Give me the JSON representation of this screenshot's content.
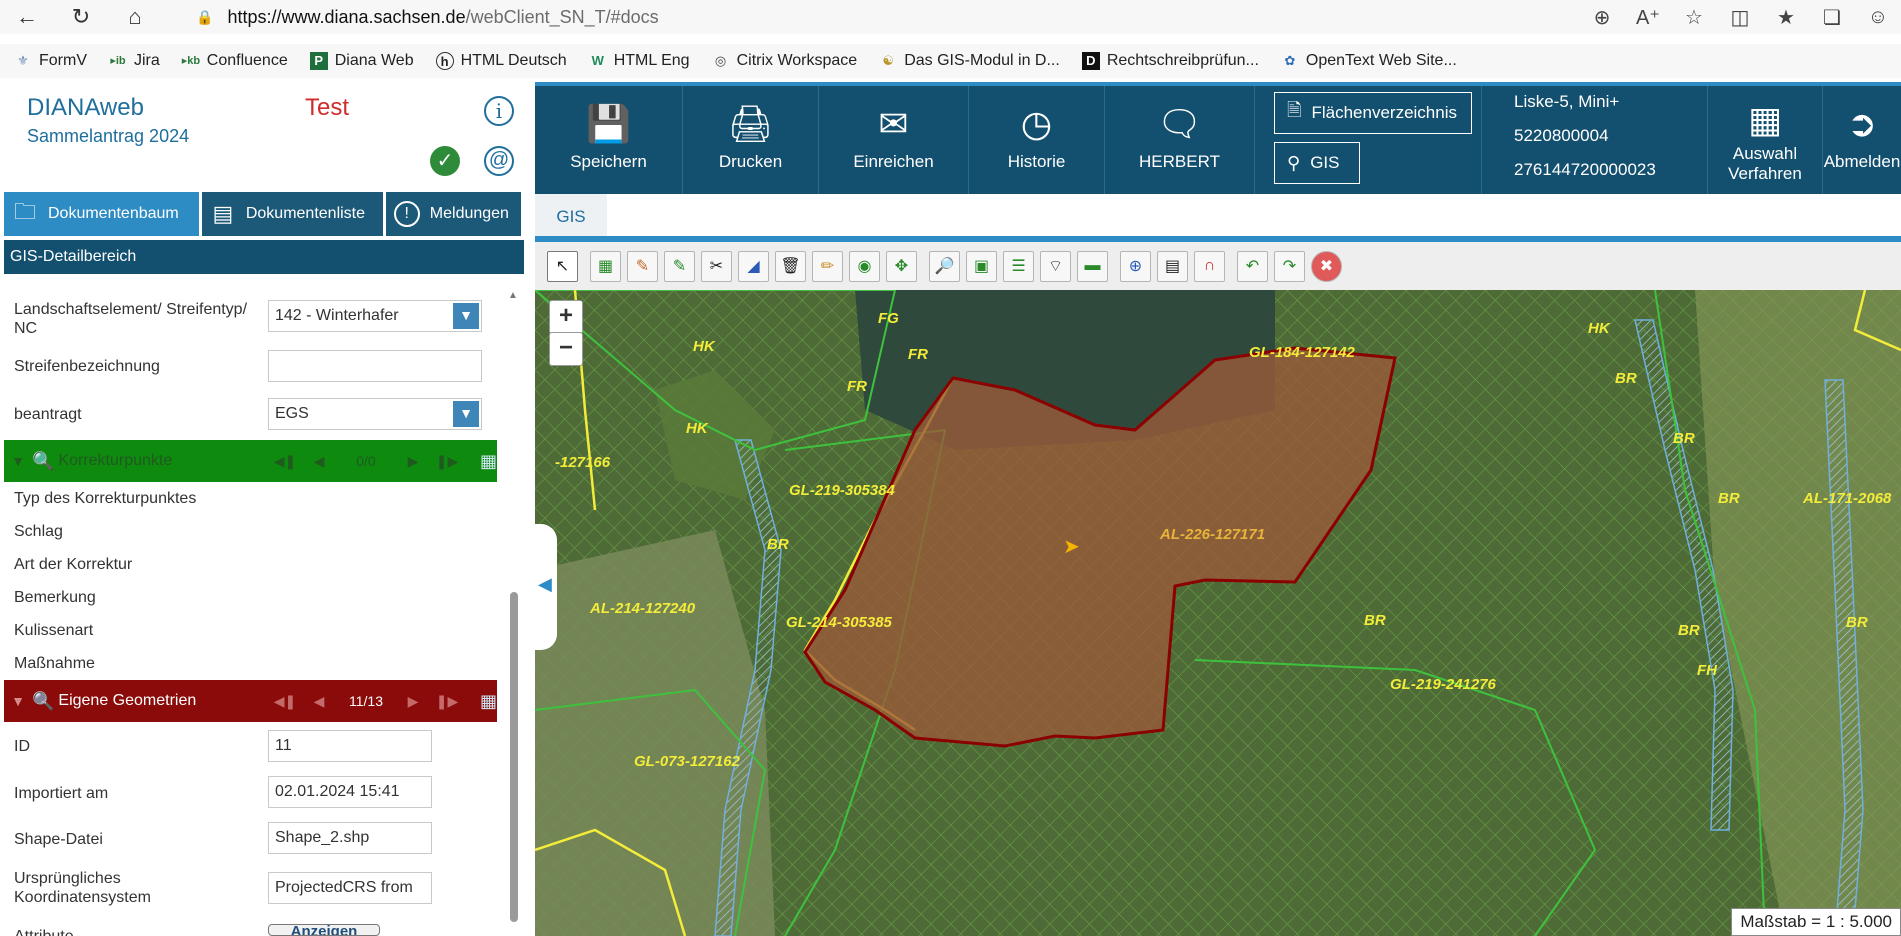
{
  "browser": {
    "url_host": "https://www.diana.sachsen.de",
    "url_path": "/webClient_SN_T/#docs"
  },
  "bookmarks": [
    {
      "label": "FormV",
      "icon": "wheat-icon"
    },
    {
      "label": "Jira",
      "icon": "kb-icon"
    },
    {
      "label": "Confluence",
      "icon": "kb-icon"
    },
    {
      "label": "Diana Web",
      "icon": "p-icon"
    },
    {
      "label": "HTML Deutsch",
      "icon": "h-icon"
    },
    {
      "label": "HTML Eng",
      "icon": "w-icon"
    },
    {
      "label": "Citrix Workspace",
      "icon": "citrix-icon"
    },
    {
      "label": "Das GIS-Modul in D...",
      "icon": "saxony-icon"
    },
    {
      "label": "Rechtschreibprüfun...",
      "icon": "d-icon"
    },
    {
      "label": "OpenText Web Site...",
      "icon": "opentext-icon"
    }
  ],
  "app": {
    "title": "DIANAweb",
    "subtitle": "Sammelantrag 2024",
    "env": "Test"
  },
  "left_tabs": [
    {
      "label": "Dokumentenbaum",
      "active": true
    },
    {
      "label": "Dokumentenliste",
      "active": false
    },
    {
      "label": "Meldungen",
      "active": false
    }
  ],
  "gis_detail": "GIS-Detailbereich",
  "form": {
    "landschaft_label": "Landschaftselement/ Streifentyp/ NC",
    "landschaft_value": "142 - Winterhafer",
    "streifen_label": "Streifenbezeichnung",
    "streifen_value": "",
    "beantragt_label": "beantragt",
    "beantragt_value": "EGS"
  },
  "korrektur": {
    "title": "Korrekturpunkte",
    "count": "0/0",
    "fields": [
      "Typ des Korrekturpunktes",
      "Schlag",
      "Art der Korrektur",
      "Bemerkung",
      "Kulissenart",
      "Maßnahme"
    ]
  },
  "eigene": {
    "title": "Eigene Geometrien",
    "count": "11/13",
    "id_label": "ID",
    "id_value": "11",
    "importiert_label": "Importiert am",
    "importiert_value": "02.01.2024 15:41",
    "shape_label": "Shape-Datei",
    "shape_value": "Shape_2.shp",
    "crs_label": "Ursprüngliches Koordinatensystem",
    "crs_value": "ProjectedCRS from",
    "attribute_label": "Attribute",
    "anzeigen_label": "Anzeigen"
  },
  "topnav": {
    "speichern": "Speichern",
    "drucken": "Drucken",
    "einreichen": "Einreichen",
    "historie": "Historie",
    "herbert": "HERBERT",
    "flaechen": "Flächenverzeichnis",
    "gis": "GIS",
    "farm_line1": "Liske-5, Mini+",
    "farm_line2": "5220800004",
    "farm_line3": "276144720000023",
    "auswahl": "Auswahl Verfahren",
    "abmelden": "Abmelden"
  },
  "gis_tab": "GIS",
  "map": {
    "labels": [
      {
        "text": "HK",
        "color": "y"
      },
      {
        "text": "FG",
        "color": "y"
      },
      {
        "text": "FR",
        "color": "y"
      },
      {
        "text": "FR",
        "color": "y"
      },
      {
        "text": "HK",
        "color": "y"
      },
      {
        "text": "GL-184-127142",
        "color": "y"
      },
      {
        "text": "HK",
        "color": "y"
      },
      {
        "text": "BR",
        "color": "y"
      },
      {
        "text": "-127166",
        "color": "y"
      },
      {
        "text": "GL-219-305384",
        "color": "y"
      },
      {
        "text": "BR",
        "color": "y"
      },
      {
        "text": "BR",
        "color": "y"
      },
      {
        "text": "BR",
        "color": "y"
      },
      {
        "text": "AL-171-2068",
        "color": "y"
      },
      {
        "text": "AL-226-127171",
        "color": "o"
      },
      {
        "text": "AL-214-127240",
        "color": "y"
      },
      {
        "text": "GL-214-305385",
        "color": "y"
      },
      {
        "text": "BR",
        "color": "y"
      },
      {
        "text": "BR",
        "color": "y"
      },
      {
        "text": "BR",
        "color": "y"
      },
      {
        "text": "GL-219-241276",
        "color": "y"
      },
      {
        "text": "FH",
        "color": "y"
      },
      {
        "text": "GL-073-127162",
        "color": "y"
      }
    ],
    "scale": "Maßstab = 1 : 5.000"
  }
}
